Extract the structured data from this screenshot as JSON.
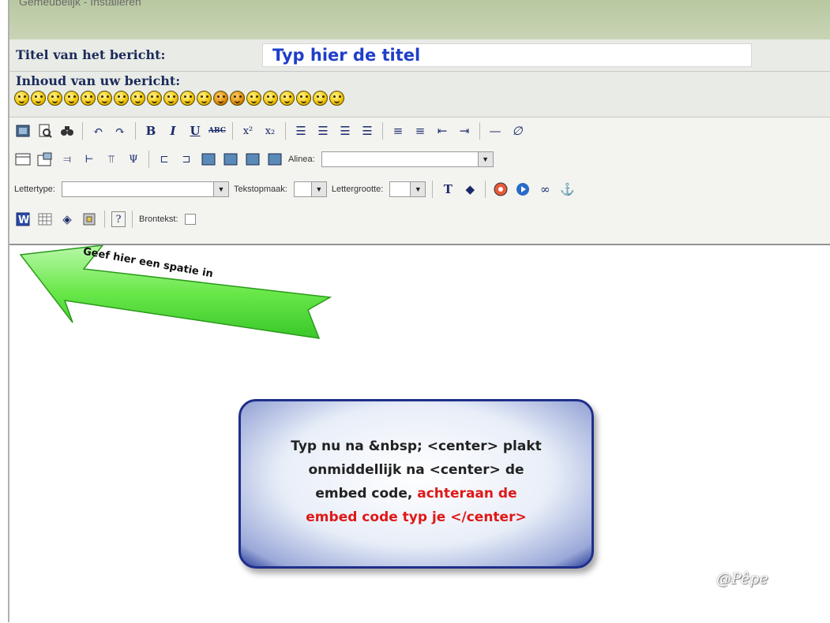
{
  "header": {
    "partial_text": "Gemeubelijk - Installeren"
  },
  "form": {
    "title_label": "Titel van het bericht:",
    "title_value": "Typ hier de titel",
    "content_label": "Inhoud van uw bericht:"
  },
  "smileys": [
    "smiley-happy",
    "smiley-laugh",
    "smiley-sad",
    "smiley-surprised",
    "smiley-cry",
    "smiley-grin",
    "smiley-cool",
    "smiley-wink",
    "smiley-angry",
    "smiley-tongue",
    "smiley-confused",
    "smiley-shock",
    "smiley-devil",
    "smiley-evil",
    "smiley-blush",
    "smiley-neutral",
    "smiley-exclamation",
    "smiley-question",
    "smiley-idea",
    "smiley-arrow"
  ],
  "toolbar": {
    "alinea_label": "Alinea:",
    "lettertype_label": "Lettertype:",
    "tekstopmaak_label": "Tekstopmaak:",
    "lettergrootte_label": "Lettergrootte:",
    "brontekst_label": "Brontekst:",
    "abc_label": "ABC",
    "colors": {
      "button_blue": "#1a2a6a"
    }
  },
  "annotations": {
    "green_arrow_text": "Geef hier een spatie in",
    "bubble_line1": "Typ nu na &nbsp; <center> plakt",
    "bubble_line2": "onmiddellijk na <center> de",
    "bubble_line3_black": "embed code,",
    "bubble_line3_red": "achteraan de",
    "bubble_line4_red": "embed code typ je </center>",
    "watermark": "@Pêpe",
    "colors": {
      "green": "#5ee84a",
      "red": "#e01818",
      "bubble_border": "#1f2f8a"
    }
  }
}
